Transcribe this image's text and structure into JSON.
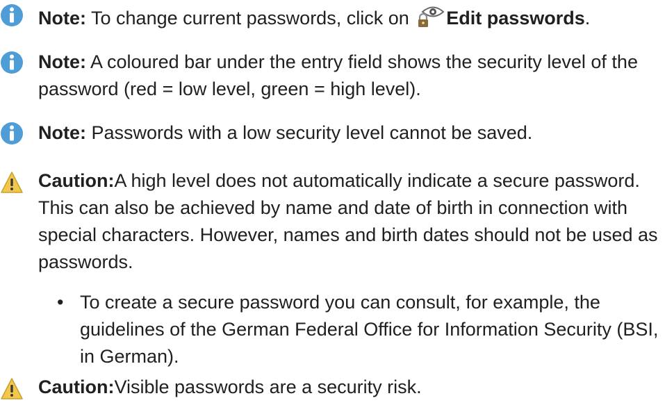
{
  "colors": {
    "info": "#4f9dd6",
    "caution": "#f1c84b",
    "text": "#202020"
  },
  "notes": [
    {
      "icon": "info-icon",
      "label": "Note:",
      "text_before": " To change current passwords, click on ",
      "link_icon": "edit-passwords-icon",
      "link_text": "Edit passwords",
      "text_after": "."
    },
    {
      "icon": "info-icon",
      "label": "Note:",
      "text": " A coloured bar under the entry field shows the security level of the password (red = low level, green = high level)."
    },
    {
      "icon": "info-icon",
      "label": "Note:",
      "text": " Passwords with a low security level cannot be saved."
    }
  ],
  "cautions": [
    {
      "icon": "warning-icon",
      "label": "Caution:",
      "text": "A high level does not automatically indicate a secure password. This can also be achieved by name and date of birth in connection with special characters. However, names and birth dates should not be used as passwords."
    },
    {
      "icon": "warning-icon",
      "label": "Caution:",
      "text": "Visible passwords are a security risk."
    }
  ],
  "bullets": [
    {
      "marker": "•",
      "text": "To create a secure password you can consult, for example, the guidelines of the German Federal Office for Information Security (BSI, in German)."
    }
  ]
}
